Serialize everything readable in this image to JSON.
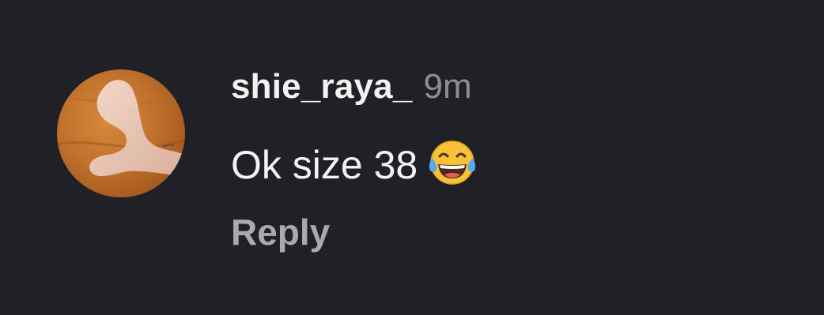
{
  "comment": {
    "username": "shie_raya_",
    "time": "9m",
    "text": "Ok size 38",
    "emoji": "face-with-tears-of-joy",
    "reply_label": "Reply"
  },
  "colors": {
    "background": "#202126",
    "username": "#f2f2f2",
    "time": "#8e8f95",
    "reply": "#a9aab0"
  }
}
